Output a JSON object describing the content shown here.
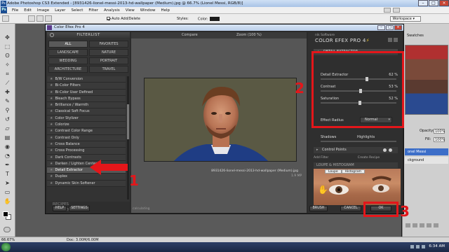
{
  "window": {
    "title": "Adobe Photoshop CS3 Extended - [8931426-lionel-messi-2013-hd-wallpaper (Medium).jpg @ 66.7% (Lionel Messi, RGB/8)]",
    "ps_label": "Ps"
  },
  "menu": [
    "File",
    "Edit",
    "Image",
    "Layer",
    "Select",
    "Filter",
    "Analysis",
    "View",
    "Window",
    "Help"
  ],
  "options_bar": {
    "auto_add_delete": "Auto Add/Delete",
    "styles": "Styles:",
    "color": "Color:",
    "workspace": "Workspace"
  },
  "plugin": {
    "title": "Color Efex Pro 4",
    "filterlist_header": "FILTERLIST",
    "categories": [
      "ALL",
      "FAVORITES",
      "LANDSCAPE",
      "NATURE",
      "WEDDING",
      "PORTRAIT",
      "ARCHITECTURE",
      "TRAVEL"
    ],
    "filters": [
      "B/W Conversion",
      "Bi-Color Filters",
      "Bi-Color User Defined",
      "Bleach Bypass",
      "Brilliance / Warmth",
      "Classical Soft Focus",
      "Color Stylizer",
      "Colorize",
      "Contrast Color Range",
      "Contrast Only",
      "Cross Balance",
      "Cross Processing",
      "Dark Contrasts",
      "Darken / Lighten Center",
      "Detail Extractor",
      "Duplex",
      "Dynamic Skin Softener"
    ],
    "selected_filter_index": 14,
    "recipes": "RECIPES",
    "history": "HISTORY",
    "help_button": "HELP",
    "settings_button": "SETTINGS",
    "compare_button": "Compare",
    "zoom_label": "Zoom (100 %)",
    "image_caption": "8931426-lionel-messi-2013-hd-wallpaper (Medium).jpg",
    "image_size": "1.9 MP",
    "status": "calculating",
    "brand": "nik Software",
    "product": "COLOR EFEX PRO",
    "product_version": "4",
    "filter_panel": {
      "name": "DETAIL EXTRACTOR",
      "sliders": [
        {
          "label": "Detail Extractor",
          "value": "62 %",
          "level": 0.62
        },
        {
          "label": "Contrast",
          "value": "53 %",
          "level": 0.53
        },
        {
          "label": "Saturation",
          "value": "52 %",
          "level": 0.52
        }
      ],
      "effect_radius_label": "Effect Radius",
      "effect_radius_value": "Normal",
      "shadows_label": "Shadows",
      "highlights_label": "Highlights",
      "control_points": "Control Points",
      "add_filter": "Add Filter",
      "create_recipe": "Create Recipe",
      "loupe_histogram": "LOUPE & HISTOGRAM",
      "loupe_tabs": [
        "Loupe",
        "Histogram"
      ]
    },
    "brush_button": "BRUSH",
    "cancel_button": "CANCEL",
    "ok_button": "OK"
  },
  "right_panel": {
    "swatches": "Swatches",
    "opacity_label": "Opacity:",
    "opacity_value": "100%",
    "fill_label": "Fill:",
    "fill_value": "100%",
    "layer_active": "onel Messi",
    "layer_bg": "ckground"
  },
  "status_bar": {
    "zoom": "66.67%",
    "doc": "Doc: 3.00M/6.00M"
  },
  "taskbar": {
    "clock": "6:34 AM"
  },
  "annotations": {
    "one": "1",
    "two": "2",
    "three": "3"
  },
  "colors": {
    "annotation_red": "#e4161a",
    "plugin_bg": "#2b2b2b"
  }
}
